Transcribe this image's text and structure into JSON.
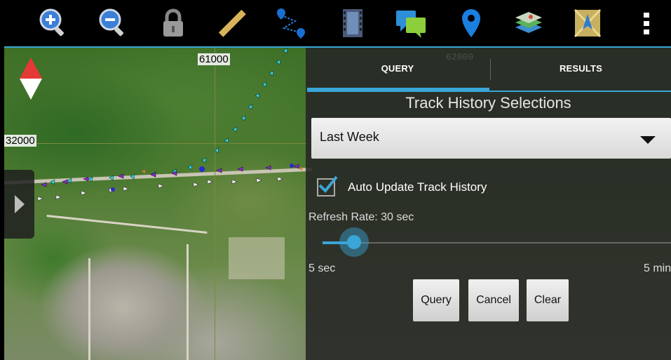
{
  "toolbar": {
    "icons": [
      "zoom-in-icon",
      "zoom-out-icon",
      "lock-icon",
      "ruler-icon",
      "route-icon",
      "video-icon",
      "chat-icon",
      "map-pin-icon",
      "layers-icon",
      "map-compass-icon",
      "overflow-menu-icon"
    ],
    "accent": "#3aa6d8"
  },
  "map": {
    "grid_label_top": "61000",
    "grid_label_left": "32000",
    "grid_label_faint": "62000"
  },
  "panel": {
    "tabs": [
      {
        "label": "QUERY",
        "active": true
      },
      {
        "label": "RESULTS",
        "active": false
      }
    ],
    "title": "Track History Selections",
    "dropdown_value": "Last Week",
    "auto_update_label": "Auto Update Track History",
    "auto_update_checked": true,
    "refresh_label": "Refresh Rate: 30 sec",
    "slider_min": "5 sec",
    "slider_max": "5 min",
    "slider_fraction": 0.09,
    "buttons": {
      "query": "Query",
      "cancel": "Cancel",
      "clear": "Clear"
    }
  }
}
